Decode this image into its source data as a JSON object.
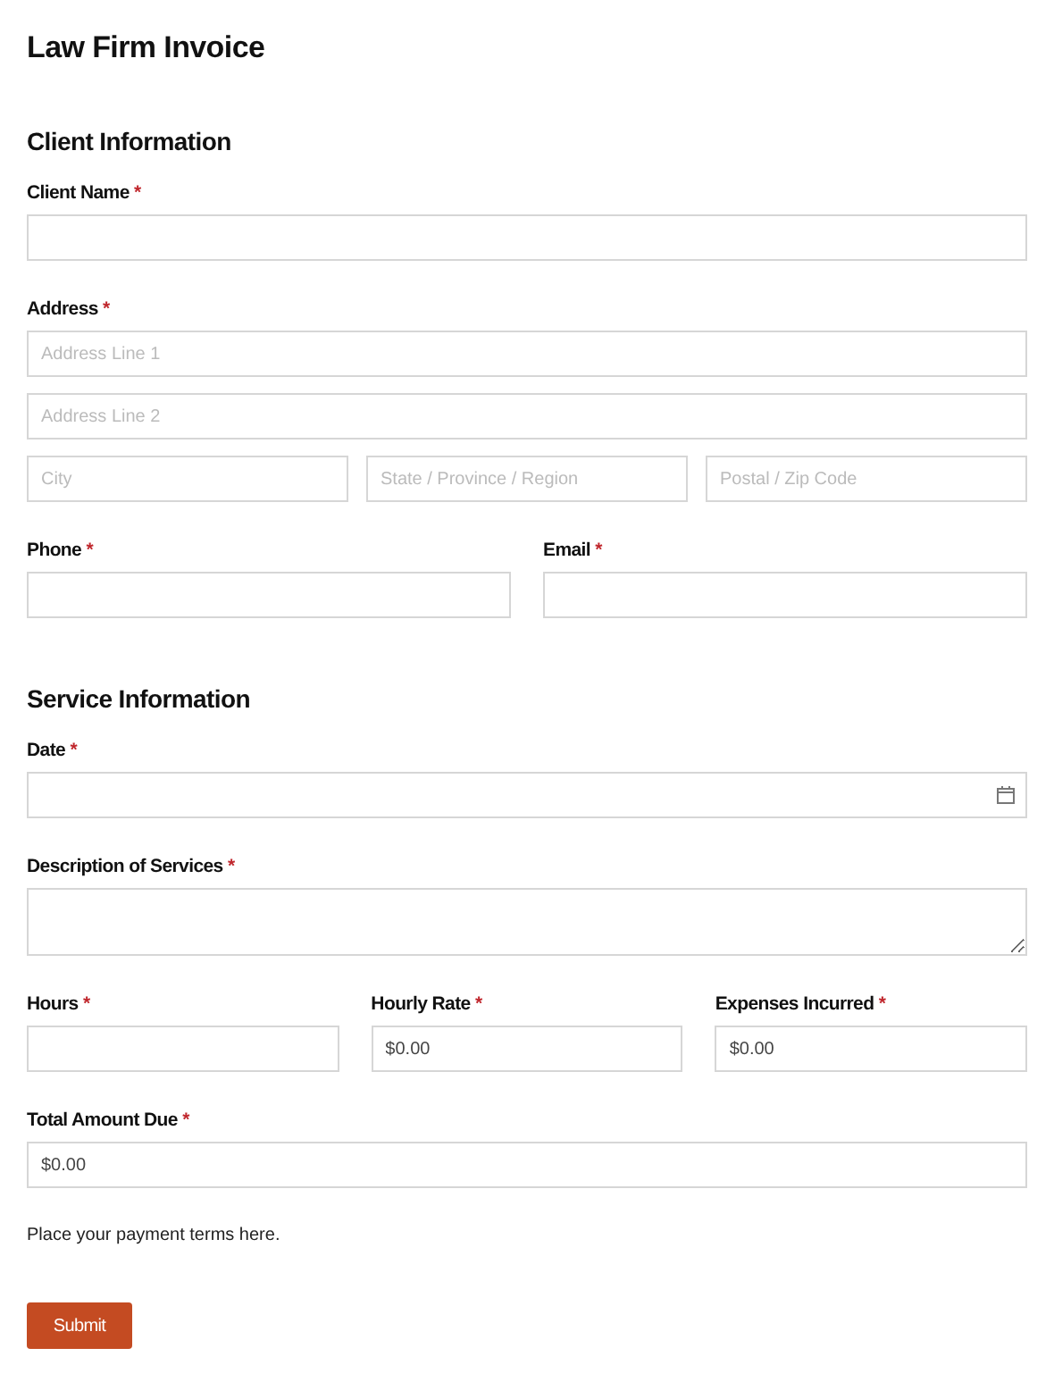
{
  "title": "Law Firm Invoice",
  "sections": [
    {
      "heading": "Client Information",
      "rows": [
        [
          {
            "label": "Client Name",
            "mark": "*",
            "lines": [
              [
                {
                  "kind": "text"
                }
              ]
            ]
          }
        ],
        [
          {
            "label": "Address",
            "mark": "*",
            "lines": [
              [
                {
                  "kind": "text",
                  "placeholder": "Address Line 1"
                }
              ],
              [
                {
                  "kind": "text",
                  "placeholder": "Address Line 2"
                }
              ],
              [
                {
                  "kind": "text",
                  "placeholder": "City"
                },
                {
                  "kind": "text",
                  "placeholder": "State / Province / Region"
                },
                {
                  "kind": "text",
                  "placeholder": "Postal / Zip Code"
                }
              ]
            ]
          }
        ],
        [
          {
            "label": "Phone",
            "mark": "*",
            "lines": [
              [
                {
                  "kind": "text"
                }
              ]
            ]
          },
          {
            "label": "Email",
            "mark": "*",
            "lines": [
              [
                {
                  "kind": "text"
                }
              ]
            ]
          }
        ]
      ]
    },
    {
      "heading": "Service Information",
      "rows": [
        [
          {
            "label": "Date",
            "mark": "*",
            "lines": [
              [
                {
                  "kind": "date"
                }
              ]
            ]
          }
        ],
        [
          {
            "label": "Description of Services",
            "mark": "*",
            "lines": [
              [
                {
                  "kind": "textarea"
                }
              ]
            ]
          }
        ],
        [
          {
            "label": "Hours",
            "mark": "*",
            "lines": [
              [
                {
                  "kind": "text"
                }
              ]
            ]
          },
          {
            "label": "Hourly Rate",
            "mark": "*",
            "lines": [
              [
                {
                  "kind": "text",
                  "value": "$0.00"
                }
              ]
            ]
          },
          {
            "label": "Expenses Incurred",
            "mark": "*",
            "lines": [
              [
                {
                  "kind": "text",
                  "value": "$0.00"
                }
              ]
            ]
          }
        ]
      ]
    },
    {
      "rows": [
        [
          {
            "label": "Total Amount Due",
            "mark": "*",
            "lines": [
              [
                {
                  "kind": "text",
                  "value": "$0.00"
                }
              ]
            ]
          }
        ]
      ]
    }
  ],
  "note": "Place your payment terms here.",
  "submit": "Submit"
}
